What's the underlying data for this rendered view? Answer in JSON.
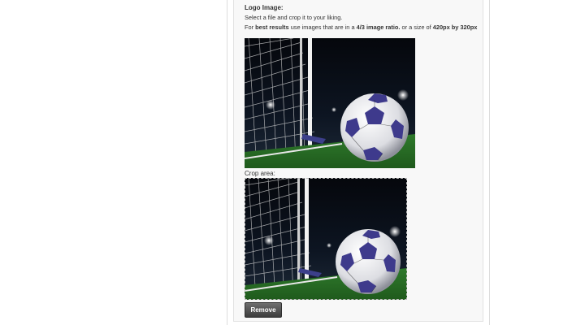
{
  "form": {
    "logo_label": "Logo Image:",
    "instruction_line1": "Select a file and crop it to your liking.",
    "instruction_for": "For ",
    "instruction_best_results": "best results",
    "instruction_use_images": " use images that are in a ",
    "instruction_ratio": "4/3 image ratio.",
    "instruction_or_size": " or a size of ",
    "instruction_size": "420px by 320px",
    "crop_label": "Crop area:",
    "remove_label": "Remove"
  },
  "images": {
    "logo_preview_icon": "soccer-ball-goal-photo",
    "crop_area_icon": "soccer-ball-goal-photo"
  }
}
